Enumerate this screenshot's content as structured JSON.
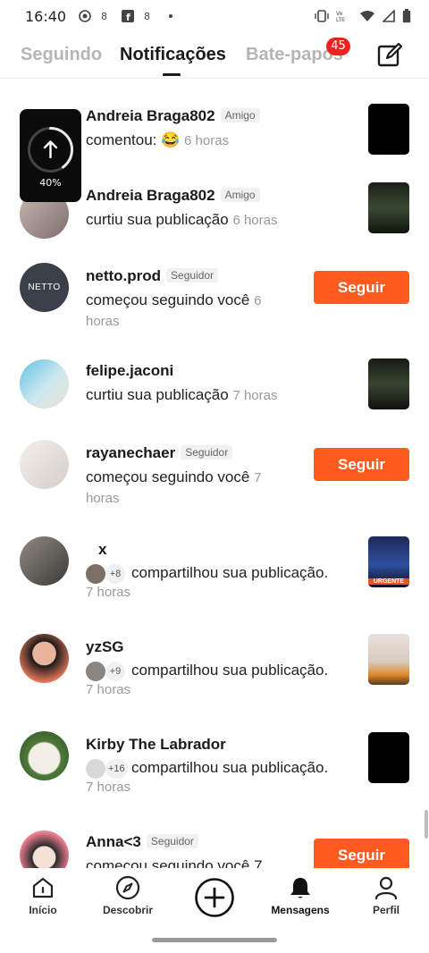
{
  "status_bar": {
    "time": "16:40"
  },
  "tabs": [
    {
      "label": "Seguindo"
    },
    {
      "label": "Notificações"
    },
    {
      "label": "Bate-papos"
    }
  ],
  "chat_badge": "45",
  "upload": {
    "progress_label": "40%",
    "progress": 0.4
  },
  "notifications": [
    {
      "user": "Andreia Braga802",
      "tag": "Amigo",
      "action": "comentou: 😂",
      "time": "6 horas"
    },
    {
      "user": "Andreia Braga802",
      "tag": "Amigo",
      "action": "curtiu sua publicação",
      "time": "6 horas"
    },
    {
      "user": "netto.prod",
      "tag": "Seguidor",
      "action": "começou seguindo você",
      "time": "6 horas",
      "button": "Seguir",
      "avatar_text": "NETTO"
    },
    {
      "user": "felipe.jaconi",
      "action": "curtiu sua publicação",
      "time": "7 horas"
    },
    {
      "user": "rayanechaer",
      "tag": "Seguidor",
      "action": "começou seguindo você",
      "time": "7 horas",
      "button": "Seguir"
    },
    {
      "user": "x",
      "count": "+8",
      "action": "compartilhou sua publicação.",
      "time": "7 horas"
    },
    {
      "user": "yzSG",
      "count": "+9",
      "action": "compartilhou sua publicação.",
      "time": "7 horas"
    },
    {
      "user": "Kirby The Labrador",
      "count": "+16",
      "action": "compartilhou sua publicação.",
      "time": "7 horas"
    },
    {
      "user": "Anna<3",
      "tag": "Seguidor",
      "action": "começou seguindo você 7",
      "button": "Seguir"
    }
  ],
  "thumbnail_text": "URGENTE",
  "bottom_nav": [
    {
      "label": "Início",
      "icon": "home-icon"
    },
    {
      "label": "Descobrir",
      "icon": "compass-icon"
    },
    {
      "label": "",
      "icon": "plus-circle-icon"
    },
    {
      "label": "Mensagens",
      "icon": "bell-icon"
    },
    {
      "label": "Perfil",
      "icon": "person-icon"
    }
  ],
  "colors": {
    "accent": "#ff5a1f",
    "badge": "#f2201f"
  }
}
